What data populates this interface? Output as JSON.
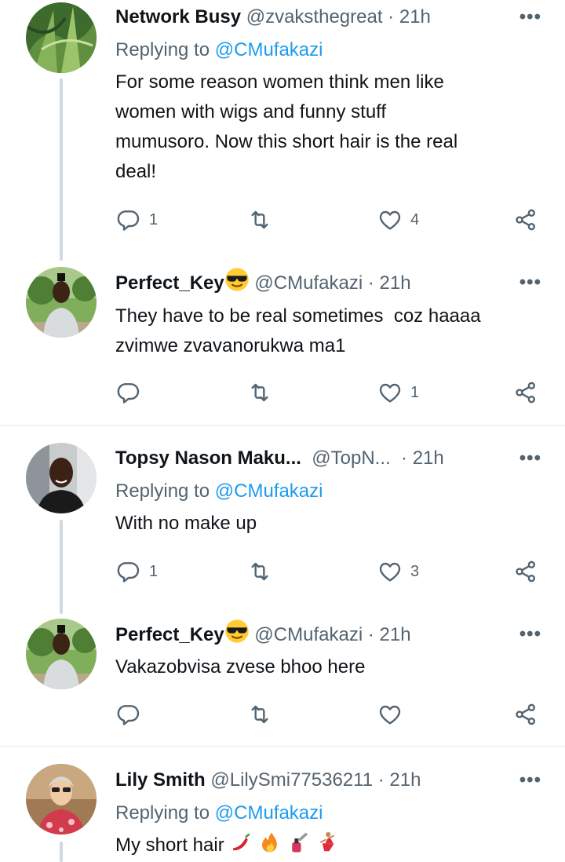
{
  "colors": {
    "text": "#0f1419",
    "muted": "#536471",
    "link": "#1d9bf0",
    "line": "#cfd9de"
  },
  "tweets": [
    {
      "name": "Network Busy",
      "handle": "@zvaksthegreat",
      "separator": "·",
      "time": "21h",
      "more": "•••",
      "replying_prefix": "Replying to ",
      "replying_to": "@CMufakazi",
      "text": "For some reason women think men like\nwomen with wigs and funny stuff\nmumusoro. Now this short hair is the real\ndeal!",
      "replies": "1",
      "retweets": "",
      "likes": "4"
    },
    {
      "name": "Perfect_Key",
      "handle": "@CMufakazi",
      "separator": "·",
      "time": "21h",
      "more": "•••",
      "text": "They have to be real sometimes  coz haaaa\nzvimwe zvavanorukwa ma1",
      "replies": "",
      "retweets": "",
      "likes": "1"
    },
    {
      "name": "Topsy Nason Maku...",
      "handle": "@TopN...",
      "separator": "·",
      "time": "21h",
      "more": "•••",
      "replying_prefix": "Replying to ",
      "replying_to": "@CMufakazi",
      "text": "With no make up",
      "replies": "1",
      "retweets": "",
      "likes": "3"
    },
    {
      "name": "Perfect_Key",
      "handle": "@CMufakazi",
      "separator": "·",
      "time": "21h",
      "more": "•••",
      "text": "Vakazobvisa zvese bhoo here",
      "replies": "",
      "retweets": "",
      "likes": ""
    },
    {
      "name": "Lily Smith",
      "handle": "@LilySmi77536211",
      "separator": "·",
      "time": "21h",
      "more": "•••",
      "replying_prefix": "Replying to ",
      "replying_to": "@CMufakazi",
      "text": "My short hair "
    }
  ]
}
